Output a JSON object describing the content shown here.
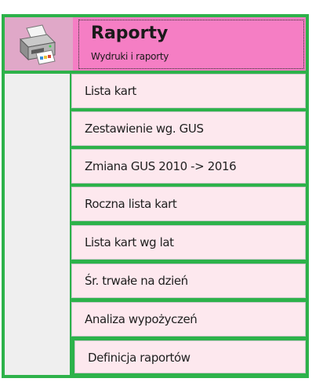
{
  "header": {
    "title": "Raporty",
    "subtitle": "Wydruki i raporty",
    "icon": "printer-icon"
  },
  "menu": {
    "items": [
      {
        "label": "Lista kart"
      },
      {
        "label": "Zestawienie wg. GUS"
      },
      {
        "label": "Zmiana GUS 2010 -> 2016"
      },
      {
        "label": "Roczna lista kart"
      },
      {
        "label": "Lista kart wg lat"
      },
      {
        "label": "Śr. trwałe na dzień"
      },
      {
        "label": "Analiza wypożyczeń"
      },
      {
        "label": "Definicja raportów"
      }
    ]
  },
  "colors": {
    "frame": "#2db24a",
    "header": "#f57ec4",
    "item_background": "#fde8ee"
  }
}
